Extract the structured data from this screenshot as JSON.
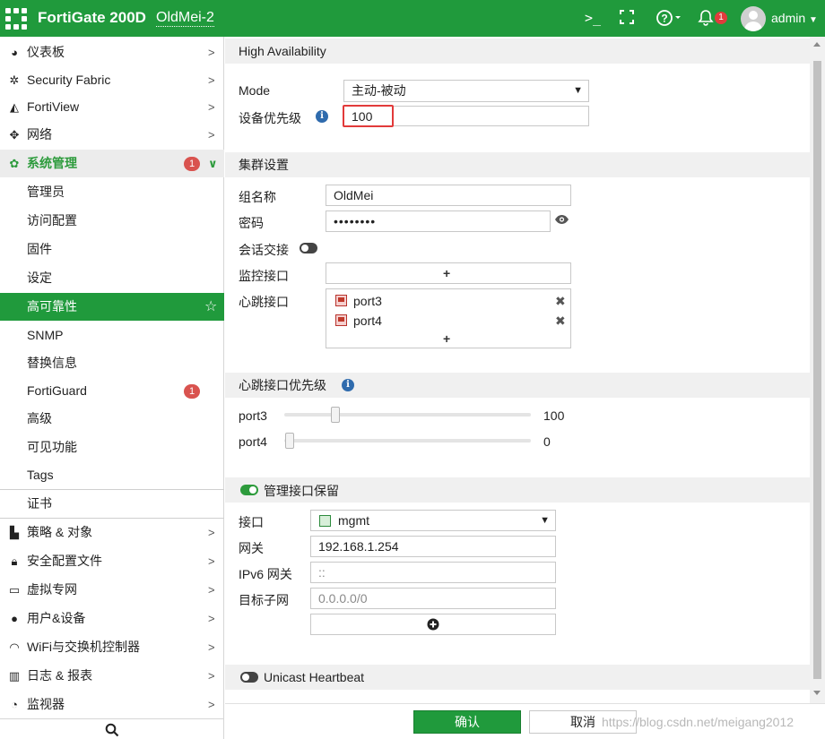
{
  "topbar": {
    "product": "FortiGate 200D",
    "hostname": "OldMei-2",
    "cli_icon": ">_",
    "fullscreen_icon": "fullscreen-icon",
    "help_icon": "?",
    "notifications_count": "1",
    "user": "admin",
    "brand_color": "#209a3c"
  },
  "sidebar": {
    "items": [
      {
        "label": "仪表板",
        "icon": "dashboard-icon"
      },
      {
        "label": "Security Fabric",
        "icon": "fabric-icon"
      },
      {
        "label": "FortiView",
        "icon": "chart-icon"
      },
      {
        "label": "网络",
        "icon": "network-icon"
      },
      {
        "label": "系统管理",
        "icon": "gear-icon",
        "badge": "1"
      },
      {
        "label": "管理员"
      },
      {
        "label": "访问配置"
      },
      {
        "label": "固件"
      },
      {
        "label": "设定"
      },
      {
        "label": "高可靠性"
      },
      {
        "label": "SNMP"
      },
      {
        "label": "替换信息"
      },
      {
        "label": "FortiGuard",
        "badge": "1"
      },
      {
        "label": "高级"
      },
      {
        "label": "可见功能"
      },
      {
        "label": "Tags"
      },
      {
        "label": "证书"
      },
      {
        "label": "策略 & 对象",
        "icon": "policy-icon"
      },
      {
        "label": "安全配置文件",
        "icon": "lock-icon"
      },
      {
        "label": "虚拟专网",
        "icon": "laptop-icon"
      },
      {
        "label": "用户&设备",
        "icon": "user-icon"
      },
      {
        "label": "WiFi与交换机控制器",
        "icon": "wifi-icon"
      },
      {
        "label": "日志 & 报表",
        "icon": "bar-chart-icon"
      },
      {
        "label": "监视器",
        "icon": "pie-icon"
      }
    ],
    "search_icon": "search-icon"
  },
  "main": {
    "section_ha": "High Availability",
    "mode_label": "Mode",
    "mode_value": "主动-被动",
    "priority_label": "设备优先级",
    "priority_value": "100",
    "section_cluster": "集群设置",
    "group_name_label": "组名称",
    "group_name_value": "OldMei",
    "password_label": "密码",
    "password_value": "••••••••",
    "session_pickup_label": "会话交接",
    "monitor_label": "监控接口",
    "heartbeat_label": "心跳接口",
    "heartbeat_ports": [
      "port3",
      "port4"
    ],
    "section_hb_priority": "心跳接口优先级",
    "hb_priority": [
      {
        "port": "port3",
        "value": "100",
        "fraction": 0.2
      },
      {
        "port": "port4",
        "value": "0",
        "fraction": 0.0
      }
    ],
    "mgmt_section": "管理接口保留",
    "iface_label": "接口",
    "iface_value": "mgmt",
    "gateway_label": "网关",
    "gateway_value": "192.168.1.254",
    "ipv6_label": "IPv6 网关",
    "ipv6_placeholder": "::",
    "subnet_label": "目标子网",
    "subnet_placeholder": "0.0.0.0/0",
    "unicast_label": "Unicast Heartbeat",
    "plus": "+"
  },
  "footer": {
    "ok": "确认",
    "cancel": "取消",
    "watermark": "https://blog.csdn.net/meigang2012"
  }
}
